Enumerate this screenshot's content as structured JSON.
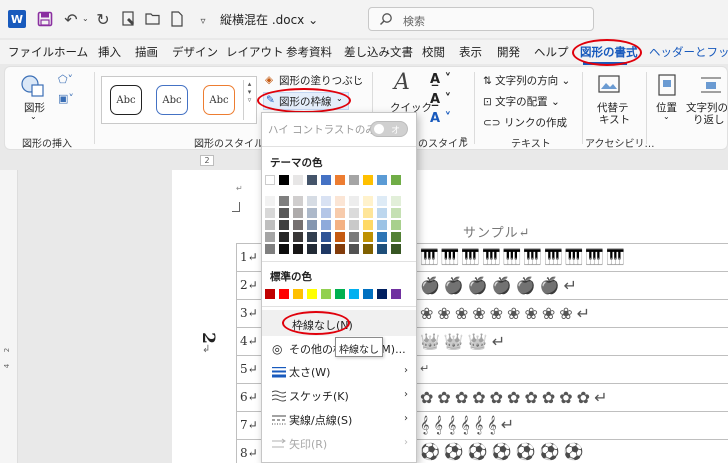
{
  "titlebar": {
    "doc_title": "縦横混在 .docx",
    "search_placeholder": "検索",
    "word_logo_letter": "W"
  },
  "tabs": [
    {
      "label": "ファイル"
    },
    {
      "label": "ホーム"
    },
    {
      "label": "挿入"
    },
    {
      "label": "描画"
    },
    {
      "label": "デザイン"
    },
    {
      "label": "レイアウト"
    },
    {
      "label": "参考資料"
    },
    {
      "label": "差し込み文書"
    },
    {
      "label": "校閲"
    },
    {
      "label": "表示"
    },
    {
      "label": "開発"
    },
    {
      "label": "ヘルプ"
    },
    {
      "label": "図形の書式"
    },
    {
      "label": "ヘッダーとフッター"
    }
  ],
  "ribbon": {
    "shape_label": "図形",
    "insert_shapes_group": "図形の挿入",
    "style_sample": "Abc",
    "shape_styles_group": "図形のスタイル",
    "fill_label": "図形の塗りつぶし",
    "outline_label": "図形の枠線",
    "quick_label": "クイック",
    "wordart_group_tail": "のスタイル",
    "text_direction": "文字列の方向",
    "text_align": "文字の配置",
    "create_link": "リンクの作成",
    "text_group": "テキスト",
    "alt_text_1": "代替テ",
    "alt_text_2": "キスト",
    "accessibility_group": "アクセシビリ…",
    "position_label": "位置",
    "wrap_label_1": "文字列の",
    "wrap_label_2": "り返し"
  },
  "ruler": {
    "tag": "2"
  },
  "vruler": {
    "mark_a": "2",
    "mark_b": "4"
  },
  "document": {
    "title_text": "サンプル↵",
    "row_numbers": [
      "1↵",
      "2↵",
      "3↵",
      "4↵",
      "5↵",
      "6↵",
      "7↵",
      "8↵"
    ],
    "big_number": "2",
    "row_icons": [
      "🎹🎹🎹🎹🎹🎹🎹🎹🎹🎹",
      "🍎🍎🍎🍎🍎🍎↵",
      "❀❀❀❀❀❀❀❀❀↵",
      "👑👑👑↵",
      "↵",
      "✿✿✿✿✿✿✿✿✿✿↵",
      "𝄞𝄞𝄞𝄞𝄞𝄞↵",
      "⚽⚽⚽⚽⚽⚽⚽"
    ]
  },
  "dropdown": {
    "high_contrast": "ハイ コントラストのみ(H)",
    "toggle_text": "オフ",
    "theme_colors": "テーマの色",
    "standard_colors": "標準の色",
    "no_outline": "枠線なし(N)",
    "more_colors": "その他の枠線の色(M)...",
    "weight": "太さ(W)",
    "sketch": "スケッチ(K)",
    "dashes": "実線/点線(S)",
    "arrows": "矢印(R)",
    "tooltip": "枠線なし",
    "theme_top_row": [
      "#ffffff",
      "#000000",
      "#e7e6e6",
      "#44546a",
      "#4472c4",
      "#ed7d31",
      "#a5a5a5",
      "#ffc000",
      "#5b9bd5",
      "#70ad47"
    ],
    "theme_shades": [
      [
        "#f2f2f2",
        "#7f7f7f",
        "#d0cece",
        "#d6dce4",
        "#d9e2f3",
        "#fbe5d5",
        "#ededed",
        "#fff2cc",
        "#deebf6",
        "#e2efd9"
      ],
      [
        "#d8d8d8",
        "#595959",
        "#aeabab",
        "#adb9ca",
        "#b4c6e7",
        "#f7cbac",
        "#dbdbdb",
        "#fee599",
        "#bdd7ee",
        "#c5e0b3"
      ],
      [
        "#bfbfbf",
        "#3f3f3f",
        "#757070",
        "#8496b0",
        "#8eaadb",
        "#f4b183",
        "#c9c9c9",
        "#ffd965",
        "#9cc3e5",
        "#a8d08d"
      ],
      [
        "#a5a5a5",
        "#262626",
        "#3a3838",
        "#323f4f",
        "#2f5496",
        "#c55a11",
        "#7b7b7b",
        "#bf9000",
        "#2e75b5",
        "#538135"
      ],
      [
        "#7f7f7f",
        "#0c0c0c",
        "#171616",
        "#222a35",
        "#1f3864",
        "#833c0b",
        "#525252",
        "#7f6000",
        "#1e4e79",
        "#375623"
      ]
    ],
    "standard_row": [
      "#c00000",
      "#ff0000",
      "#ffc000",
      "#ffff00",
      "#92d050",
      "#00b050",
      "#00b0f0",
      "#0070c0",
      "#002060",
      "#7030a0"
    ]
  },
  "colors": {
    "accent": "#185abd",
    "highlight_oval": "#e0000b"
  }
}
